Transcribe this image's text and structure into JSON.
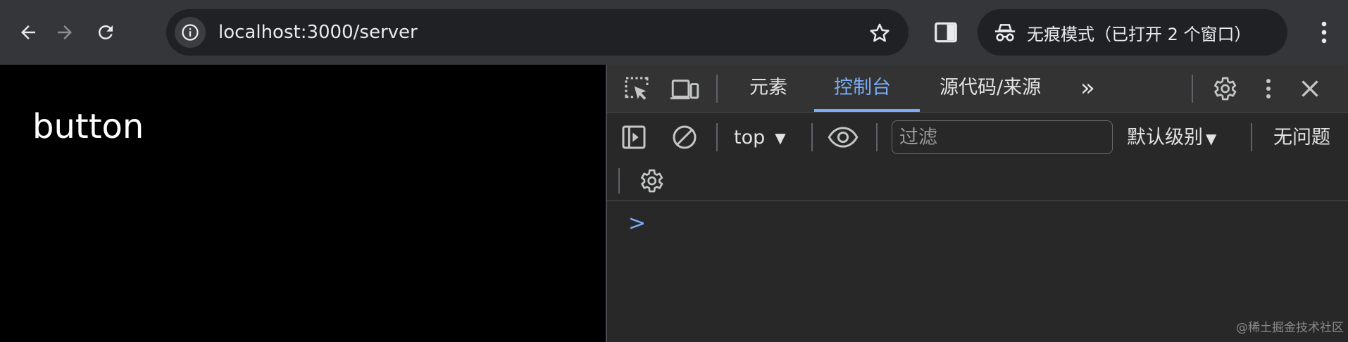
{
  "browser": {
    "url": "localhost:3000/server",
    "incognito_label": "无痕模式（已打开 2 个窗口）",
    "icons": [
      "back-icon",
      "forward-icon",
      "reload-icon",
      "site-info-icon",
      "bookmark-star-icon",
      "side-panel-icon",
      "incognito-icon",
      "browser-menu-icon"
    ]
  },
  "page": {
    "text": "button"
  },
  "devtools": {
    "tabs": [
      {
        "label": "元素",
        "active": false
      },
      {
        "label": "控制台",
        "active": true
      },
      {
        "label": "源代码/来源",
        "active": false
      }
    ],
    "more_tabs_label": "»",
    "console": {
      "context": "top",
      "filter_placeholder": "过滤",
      "filter_value": "",
      "levels": "默认级别",
      "issues": "无问题",
      "prompt": ">"
    },
    "accent_color": "#7cacf8"
  },
  "watermark": "@稀土掘金技术社区"
}
